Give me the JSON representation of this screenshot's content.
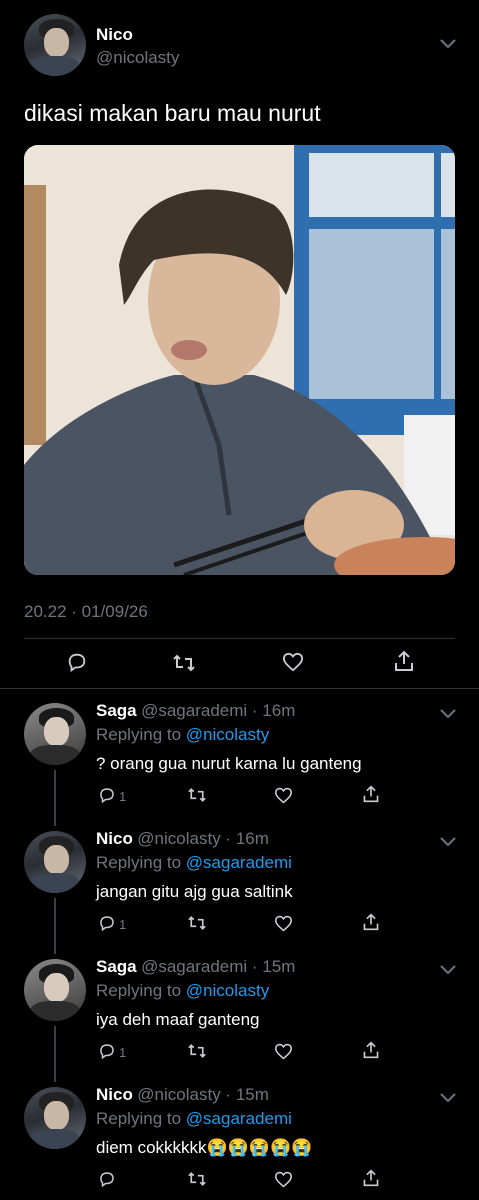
{
  "tweet": {
    "name": "Nico",
    "handle": "@nicolasty",
    "text": "dikasi makan baru mau nurut",
    "timestamp": "20.22 · 01/09/26"
  },
  "replies": [
    {
      "name": "Saga",
      "handle": "@sagarademi",
      "time": "16m",
      "replying_prefix": "Replying to",
      "replying_to": "@nicolasty",
      "text": "? orang gua nurut karna lu ganteng",
      "reply_count": "1"
    },
    {
      "name": "Nico",
      "handle": "@nicolasty",
      "time": "16m",
      "replying_prefix": "Replying to",
      "replying_to": "@sagarademi",
      "text": "jangan gitu ajg gua saltink",
      "reply_count": "1"
    },
    {
      "name": "Saga",
      "handle": "@sagarademi",
      "time": "15m",
      "replying_prefix": "Replying to",
      "replying_to": "@nicolasty",
      "text": "iya deh maaf ganteng",
      "reply_count": "1"
    },
    {
      "name": "Nico",
      "handle": "@nicolasty",
      "time": "15m",
      "replying_prefix": "Replying to",
      "replying_to": "@sagarademi",
      "text": "diem cokkkkkk😭😭😭😭😭",
      "reply_count": ""
    }
  ],
  "colors": {
    "background": "#000000",
    "link": "#1d9bf0",
    "muted": "#6e767d",
    "divider": "#2f3336"
  },
  "icons": [
    "reply-icon",
    "retweet-icon",
    "like-icon",
    "share-icon",
    "chevron-down-icon"
  ]
}
